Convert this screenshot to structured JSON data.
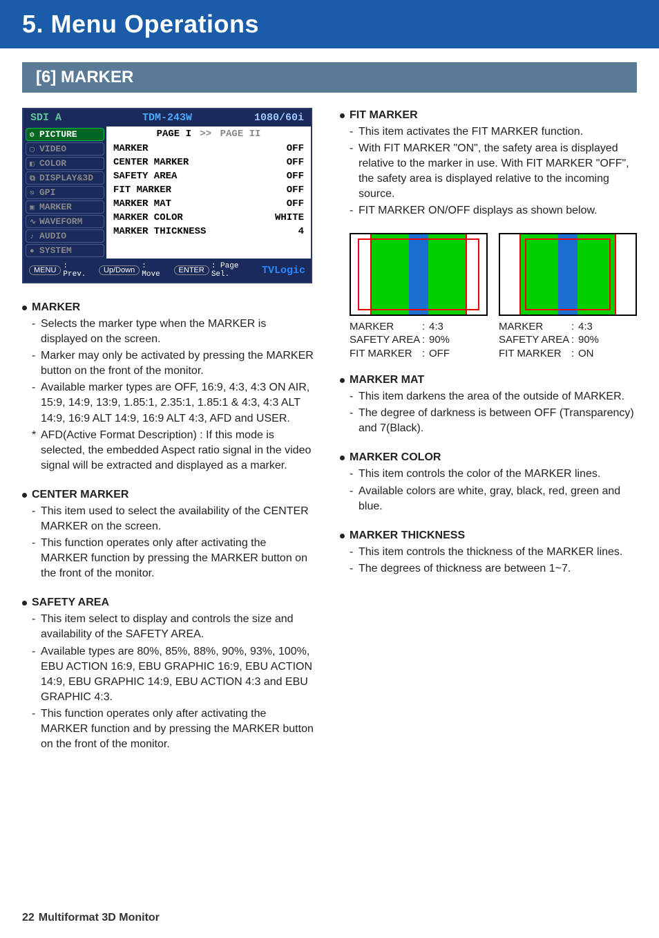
{
  "chapter_title": "5. Menu Operations",
  "section_title": "[6] MARKER",
  "osd": {
    "source": "SDI A",
    "model": "TDM-243W",
    "signal": "1080/60i",
    "tabs": [
      "PICTURE",
      "VIDEO",
      "COLOR",
      "DISPLAY&3D",
      "GPI",
      "MARKER",
      "WAVEFORM",
      "AUDIO",
      "SYSTEM"
    ],
    "active_tab_index": 0,
    "page_from": "PAGE I",
    "page_sep": ">>",
    "page_to": "PAGE II",
    "rows": [
      {
        "label": "MARKER",
        "value": "OFF"
      },
      {
        "label": "CENTER MARKER",
        "value": "OFF"
      },
      {
        "label": "SAFETY AREA",
        "value": "OFF"
      },
      {
        "label": "FIT MARKER",
        "value": "OFF"
      },
      {
        "label": "MARKER MAT",
        "value": "OFF"
      },
      {
        "label": "MARKER COLOR",
        "value": "WHITE"
      },
      {
        "label": "MARKER THICKNESS",
        "value": "4"
      }
    ],
    "footer": {
      "menu_btn": "MENU",
      "menu_lbl": ": Prev.",
      "updown_btn": "Up/Down",
      "updown_lbl": ": Move",
      "enter_btn": "ENTER",
      "enter_lbl": ": Page Sel.",
      "logo": "TVLogic"
    }
  },
  "left_items": [
    {
      "title": "MARKER",
      "lines": [
        {
          "prefix": "-",
          "text": "Selects the marker type when the MARKER is displayed on the screen."
        },
        {
          "prefix": "-",
          "text": "Marker may only be activated by pressing the MARKER button on the front of the monitor."
        },
        {
          "prefix": "-",
          "text": "Available marker types are OFF, 16:9, 4:3, 4:3 ON AIR, 15:9, 14:9, 13:9, 1.85:1, 2.35:1, 1.85:1 & 4:3, 4:3 ALT 14:9, 16:9 ALT 14:9, 16:9 ALT 4:3, AFD and USER."
        },
        {
          "prefix": "*",
          "text": "AFD(Active Format Description) : If this mode is selected, the embedded Aspect ratio signal in the video signal will be extracted and displayed as a marker."
        }
      ]
    },
    {
      "title": "CENTER MARKER",
      "lines": [
        {
          "prefix": "-",
          "text": "This item used to select the availability of the CENTER MARKER on the screen."
        },
        {
          "prefix": "-",
          "text": "This function operates only after activating the MARKER function by pressing the MARKER button on the front of the monitor."
        }
      ]
    },
    {
      "title": "SAFETY AREA",
      "lines": [
        {
          "prefix": "-",
          "text": "This item select to display and controls the size and availability of the SAFETY AREA."
        },
        {
          "prefix": "-",
          "text": "Available types are 80%, 85%, 88%, 90%, 93%, 100%, EBU ACTION 16:9, EBU GRAPHIC 16:9, EBU ACTION 14:9, EBU GRAPHIC 14:9, EBU ACTION 4:3 and EBU GRAPHIC 4:3."
        },
        {
          "prefix": "-",
          "text": "This function operates only after activating the MARKER function and by pressing the MARKER button on the front of the monitor."
        }
      ]
    }
  ],
  "right_items_top": [
    {
      "title": "FIT MARKER",
      "lines": [
        {
          "prefix": "-",
          "text": "This item activates the FIT MARKER function."
        },
        {
          "prefix": "-",
          "text": "With FIT MARKER \"ON\", the safety area is displayed relative to the marker in use. With FIT MARKER \"OFF\", the safety area is displayed relative to the incoming source."
        },
        {
          "prefix": "-",
          "text": "FIT MARKER ON/OFF displays as shown below."
        }
      ]
    }
  ],
  "diagrams": [
    {
      "caption": [
        {
          "k": "MARKER",
          "v": "4:3"
        },
        {
          "k": "SAFETY AREA",
          "v": "90%"
        },
        {
          "k": "FIT MARKER",
          "v": "OFF"
        }
      ]
    },
    {
      "caption": [
        {
          "k": "MARKER",
          "v": "4:3"
        },
        {
          "k": "SAFETY AREA",
          "v": "90%"
        },
        {
          "k": "FIT MARKER",
          "v": "ON"
        }
      ]
    }
  ],
  "right_items_bottom": [
    {
      "title": "MARKER MAT",
      "lines": [
        {
          "prefix": "-",
          "text": "This item darkens the area of the outside of MARKER."
        },
        {
          "prefix": "-",
          "text": "The degree of darkness is between OFF (Transparency) and 7(Black)."
        }
      ]
    },
    {
      "title": "MARKER COLOR",
      "lines": [
        {
          "prefix": "-",
          "text": "This item controls the color of the MARKER lines."
        },
        {
          "prefix": "-",
          "text": "Available colors are white, gray, black, red, green and blue."
        }
      ]
    },
    {
      "title": "MARKER THICKNESS",
      "lines": [
        {
          "prefix": "-",
          "text": "This item controls the thickness of the MARKER lines."
        },
        {
          "prefix": "-",
          "text": "The degrees of thickness are between 1~7."
        }
      ]
    }
  ],
  "footer": {
    "page": "22",
    "title": "Multiformat 3D Monitor"
  }
}
